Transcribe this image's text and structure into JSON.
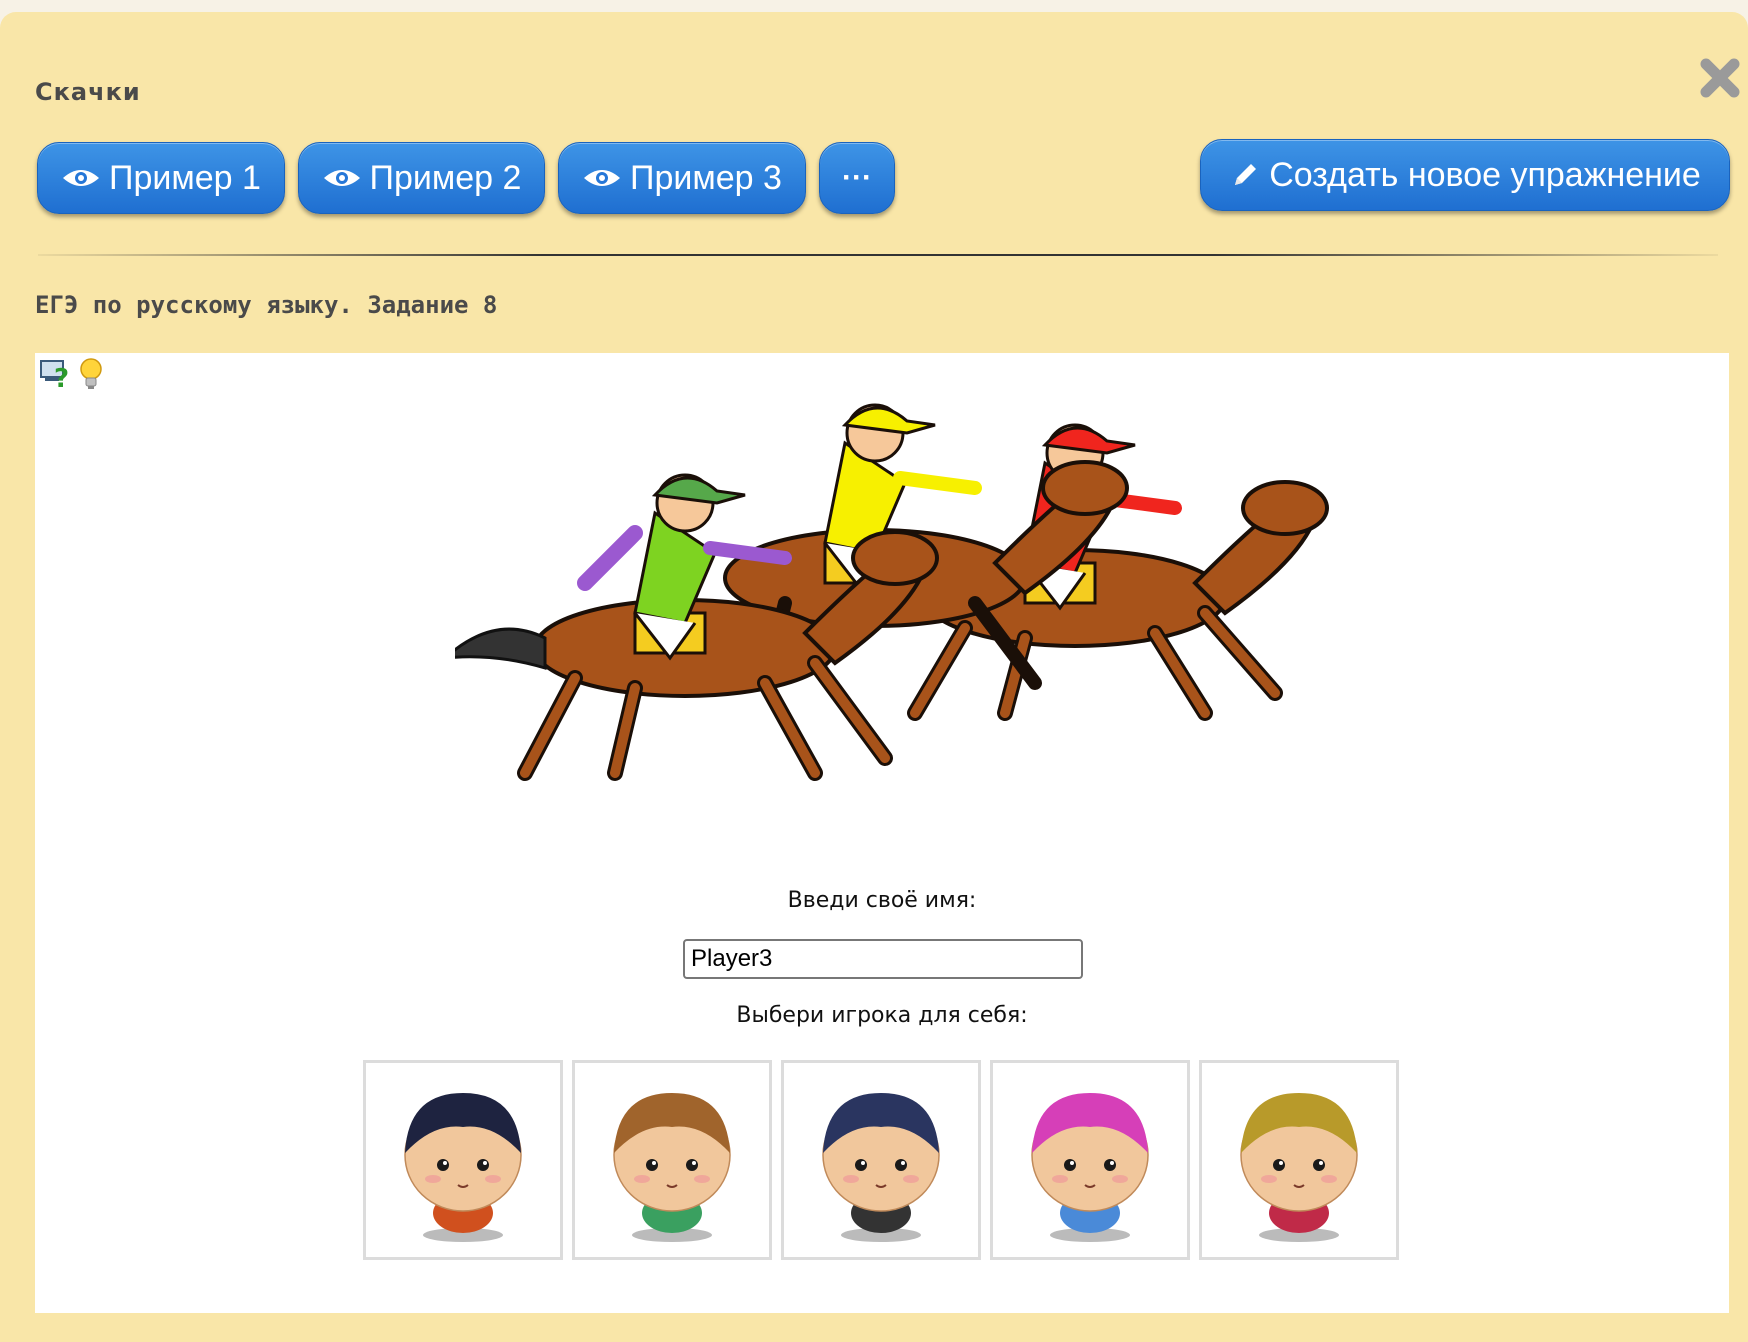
{
  "dialog": {
    "title": "Скачки",
    "close_icon": "close-icon"
  },
  "toolbar": {
    "examples": [
      {
        "label": "Пример 1",
        "icon": "eye-icon"
      },
      {
        "label": "Пример 2",
        "icon": "eye-icon"
      },
      {
        "label": "Пример 3",
        "icon": "eye-icon"
      }
    ],
    "more_label": "···",
    "create_label": "Создать новое упражнение",
    "create_icon": "pencil-icon"
  },
  "subtitle": "ЕГЭ по русскому языку. Задание 8",
  "game": {
    "help_icon": "help-screen-icon",
    "hint_icon": "lightbulb-icon",
    "illustration": "horse-race-illustration",
    "name_label": "Введи своё имя:",
    "name_value": "Player3",
    "pick_label": "Выбери игрока для себя:",
    "avatars": [
      {
        "icon": "avatar-dark-hair-icon",
        "hair": "#1e2340",
        "shirt": "#d0501e"
      },
      {
        "icon": "avatar-cat-hat-icon",
        "hair": "#a0642c",
        "shirt": "#3aa060"
      },
      {
        "icon": "avatar-pirate-hat-icon",
        "hair": "#2a3560",
        "shirt": "#333333"
      },
      {
        "icon": "avatar-pink-hair-icon",
        "hair": "#d63fb8",
        "shirt": "#4a8ad8"
      },
      {
        "icon": "avatar-blond-hair-icon",
        "hair": "#b89a2a",
        "shirt": "#c02a48"
      }
    ]
  },
  "colors": {
    "dialog_bg": "#f9e6a8",
    "button_blue": "#2a7fdb",
    "panel_bg": "#ffffff"
  }
}
